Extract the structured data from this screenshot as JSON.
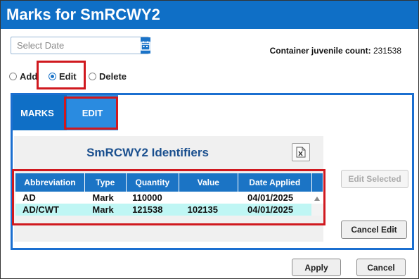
{
  "window": {
    "title": "Marks for SmRCWY2"
  },
  "date_filter": {
    "placeholder": "Select Date",
    "icon": "calendar-icon"
  },
  "count": {
    "label": "Container juvenile count:",
    "value": "231538"
  },
  "mode": {
    "options": [
      {
        "label": "Add",
        "selected": false
      },
      {
        "label": "Edit",
        "selected": true
      },
      {
        "label": "Delete",
        "selected": false
      }
    ]
  },
  "tabs": [
    {
      "label": "MARKS",
      "active": false
    },
    {
      "label": "EDIT",
      "active": true
    }
  ],
  "grid": {
    "title": "SmRCWY2 Identifiers",
    "export_icon": "excel-export-icon",
    "columns": [
      "Abbreviation",
      "Type",
      "Quantity",
      "Value",
      "Date Applied"
    ],
    "rows": [
      [
        "AD",
        "Mark",
        "110000",
        "",
        "04/01/2025"
      ],
      [
        "AD/CWT",
        "Mark",
        "121538",
        "102135",
        "04/01/2025"
      ]
    ],
    "scroll_icon": "scroll-up-icon"
  },
  "actions": {
    "edit_selected": "Edit Selected",
    "cancel_edit": "Cancel Edit",
    "apply": "Apply",
    "cancel": "Cancel"
  },
  "colors": {
    "primary": "#0f6fc6",
    "highlight_row": "#bff6f4",
    "annotation": "#d0191f"
  }
}
